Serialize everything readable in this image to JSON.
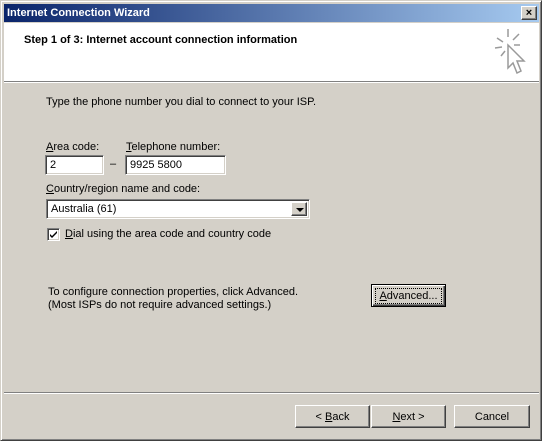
{
  "window": {
    "title": "Internet Connection Wizard",
    "close_glyph": "×"
  },
  "header": {
    "title": "Step 1 of 3: Internet account connection information",
    "icon": "wizard-cursor-icon"
  },
  "body": {
    "intro": "Type the phone number you dial to connect to your ISP.",
    "area_code_label_key": "A",
    "area_code_label_rest": "rea code:",
    "area_code_value": "2",
    "dash": "–",
    "phone_label_key": "T",
    "phone_label_rest": "elephone number:",
    "phone_value": "9925 5800",
    "country_label_key": "C",
    "country_label_rest": "ountry/region name and code:",
    "country_value": "Australia (61)",
    "checkbox_checked": true,
    "checkbox_label_key": "D",
    "checkbox_label_rest": "ial using the area code and country code",
    "advanced_note_line1": "To configure connection properties, click Advanced.",
    "advanced_note_line2": "(Most ISPs do not require advanced settings.)",
    "advanced_key": "A",
    "advanced_rest": "dvanced..."
  },
  "footer": {
    "back_prefix": "< ",
    "back_key": "B",
    "back_rest": "ack",
    "next_key": "N",
    "next_rest": "ext >",
    "cancel_label": "Cancel"
  }
}
